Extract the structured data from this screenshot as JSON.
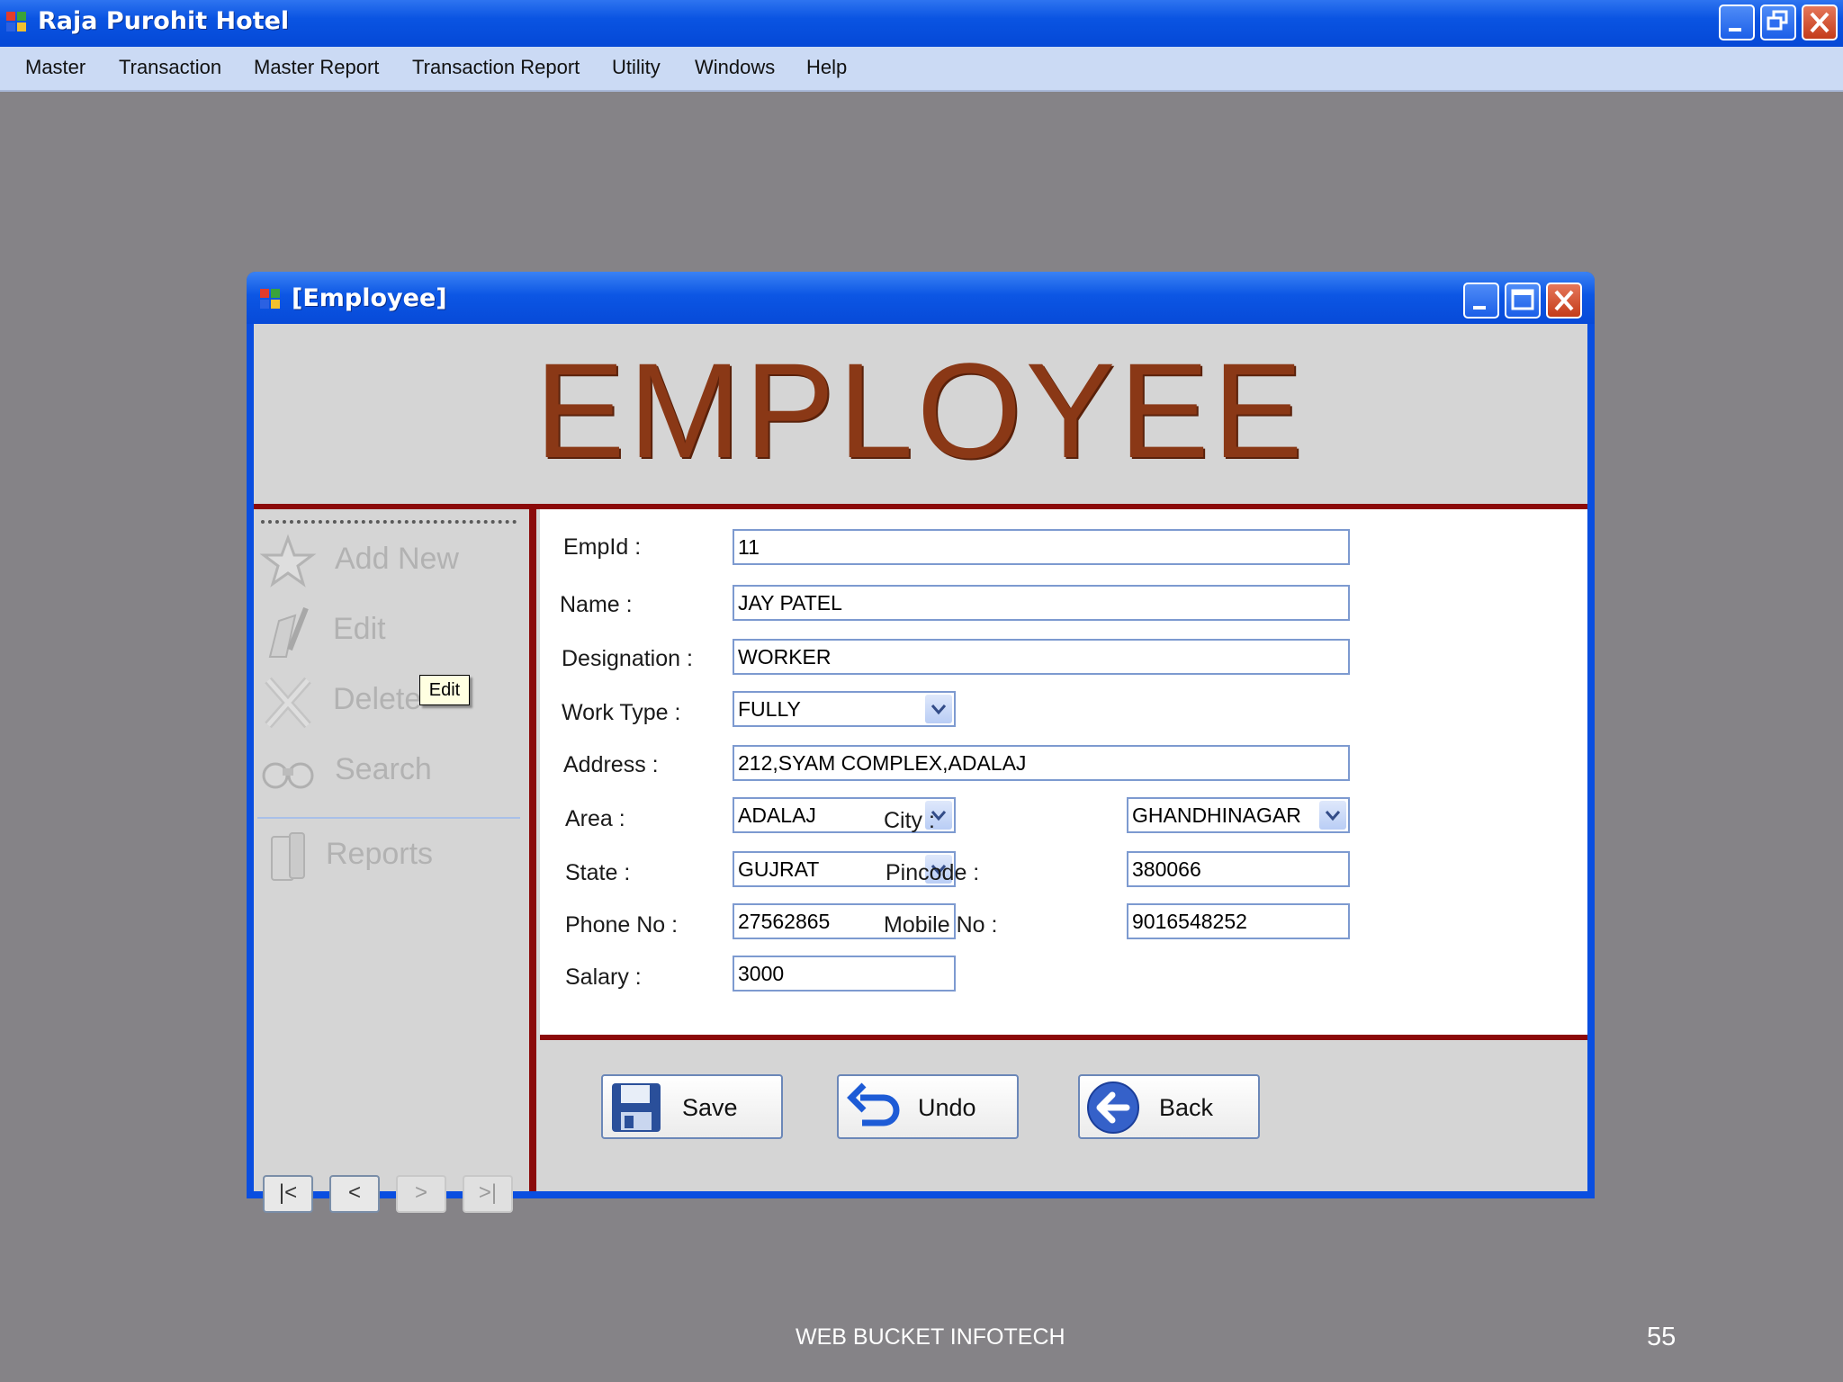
{
  "app": {
    "title": "Raja Purohit Hotel",
    "menu": [
      "Master",
      "Transaction",
      "Master Report",
      "Transaction Report",
      "Utility",
      "Windows",
      "Help"
    ]
  },
  "child": {
    "title": "[Employee]",
    "banner": "EMPLOYEE"
  },
  "sidebar": {
    "add_new": "Add New",
    "edit": "Edit",
    "delete": "Delete",
    "search": "Search",
    "reports": "Reports",
    "tooltip": "Edit",
    "nav_first": "|<",
    "nav_prev": "<",
    "nav_next": ">",
    "nav_last": ">|"
  },
  "form": {
    "empid_label": "EmpId :",
    "empid": "11",
    "name_label": "Name :",
    "name": "JAY PATEL",
    "designation_label": "Designation :",
    "designation": "WORKER",
    "worktype_label": "Work Type :",
    "worktype": "FULLY",
    "address_label": "Address :",
    "address": "212,SYAM COMPLEX,ADALAJ",
    "area_label": "Area :",
    "area": "ADALAJ",
    "city_label": "City :",
    "city": "GHANDHINAGAR",
    "state_label": "State :",
    "state": "GUJRAT",
    "pincode_label": "Pincode :",
    "pincode": "380066",
    "phone_label": "Phone No :",
    "phone": "27562865",
    "mobile_label": "Mobile No :",
    "mobile": "9016548252",
    "salary_label": "Salary :",
    "salary": "3000"
  },
  "actions": {
    "save": "Save",
    "undo": "Undo",
    "back": "Back"
  },
  "slide": {
    "footer": "WEB BUCKET INFOTECH",
    "page": "55"
  },
  "colors": {
    "titlebar": "#0a54e2",
    "banner_text": "#8a3816",
    "accent_line": "#8b0a0a",
    "desktop": "#858387"
  }
}
